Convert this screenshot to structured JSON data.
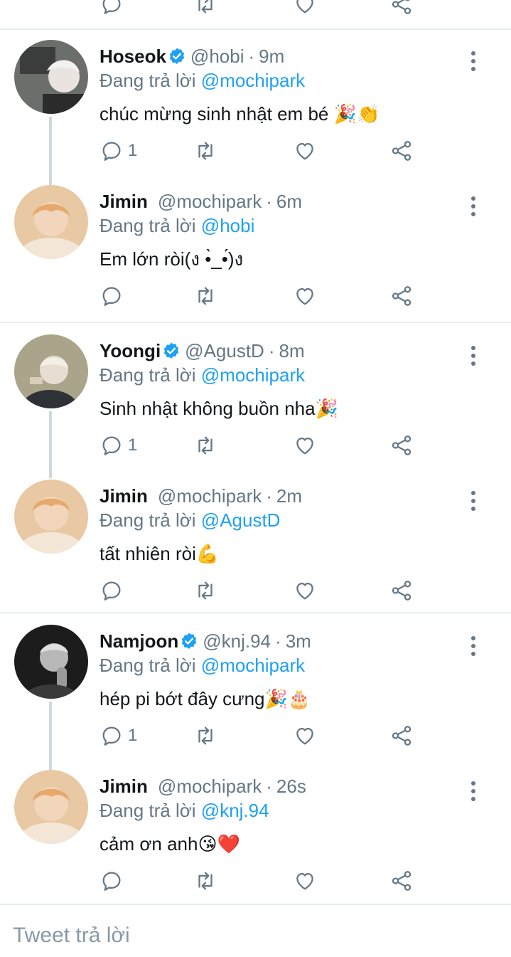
{
  "reply_label": "Đang trả lời",
  "tweets": [
    {
      "name": "Hoseok",
      "verified": true,
      "handle": "@hobi",
      "time": "9m",
      "reply_to": "@mochipark",
      "text": "chúc mừng sinh nhật em bé 🎉👏",
      "reply_count": "1"
    },
    {
      "name": "Jimin",
      "verified": false,
      "handle": "@mochipark",
      "time": "6m",
      "reply_to": "@hobi",
      "text": "Em lớn ròi(ง •̀_•́)ง",
      "reply_count": ""
    },
    {
      "name": "Yoongi",
      "verified": true,
      "handle": "@AgustD",
      "time": "8m",
      "reply_to": "@mochipark",
      "text": "Sinh nhật không buồn nha🎉",
      "reply_count": "1"
    },
    {
      "name": "Jimin",
      "verified": false,
      "handle": "@mochipark",
      "time": "2m",
      "reply_to": "@AgustD",
      "text": "tất nhiên ròi💪",
      "reply_count": ""
    },
    {
      "name": "Namjoon",
      "verified": true,
      "handle": "@knj.94",
      "time": "3m",
      "reply_to": "@mochipark",
      "text": "hép pi bớt đây cưng🎉🎂",
      "reply_count": "1"
    },
    {
      "name": "Jimin",
      "verified": false,
      "handle": "@mochipark",
      "time": "26s",
      "reply_to": "@knj.94",
      "text": "cảm ơn anh😘❤️",
      "reply_count": ""
    }
  ],
  "composer": {
    "placeholder": "Tweet trả lời"
  },
  "colors": {
    "accent": "#1da1f2",
    "text": "#14171a",
    "muted": "#657786",
    "divider": "#e6ecf0"
  },
  "icons": [
    "reply-icon",
    "retweet-icon",
    "like-icon",
    "share-icon",
    "more-icon",
    "verified-icon"
  ]
}
